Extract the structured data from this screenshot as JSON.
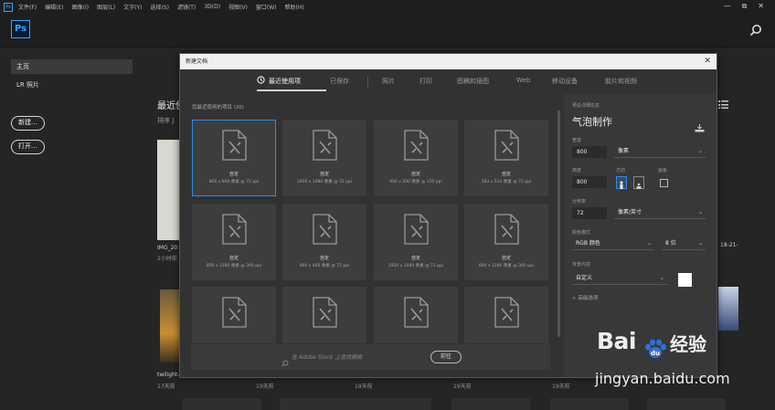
{
  "menubar": {
    "app_icon": "Ps",
    "items": [
      "文件(F)",
      "编辑(E)",
      "图像(I)",
      "图层(L)",
      "文字(Y)",
      "选择(S)",
      "滤镜(T)",
      "3D(D)",
      "视图(V)",
      "窗口(W)",
      "帮助(H)"
    ],
    "controls": [
      "—",
      "⧉",
      "✕"
    ]
  },
  "toolbar": {
    "logo": "Ps",
    "search_icon": "search-icon"
  },
  "sidebar": {
    "items": [
      {
        "label": "主页"
      },
      {
        "label": "LR 照片"
      }
    ],
    "new_button": "新建...",
    "open_button": "打开..."
  },
  "home": {
    "recent_title": "最近使",
    "sort_label": "排序  J",
    "captions_left": {
      "c1": "IMG_20",
      "c1b": "2小时前",
      "c2": "twilight-",
      "c2b": "17天前"
    },
    "captions_bottom": [
      {
        "name": "",
        "time": "19天前"
      },
      {
        "name": "",
        "time": "19天前"
      },
      {
        "name": "",
        "time": "19天前"
      },
      {
        "name": "",
        "time": "19天前"
      }
    ],
    "right_caption": "18-21-"
  },
  "dialog": {
    "title": "新建文档",
    "tabs": [
      {
        "label": "最近使用项",
        "active": true
      },
      {
        "label": "已保存",
        "active": false
      },
      {
        "label": "照片",
        "active": false
      },
      {
        "label": "打印",
        "active": false
      },
      {
        "label": "图稿和插图",
        "active": false
      },
      {
        "label": "Web",
        "active": false
      },
      {
        "label": "移动设备",
        "active": false
      },
      {
        "label": "胶片和视频",
        "active": false
      }
    ],
    "recent_header": "您最近使用的项目 (20)",
    "tiles": [
      {
        "name": "自定",
        "size": "800 x 800 像素 @ 72 ppi",
        "selected": true
      },
      {
        "name": "自定",
        "size": "1920 x 1080 像素 @ 72 ppi",
        "selected": false
      },
      {
        "name": "自定",
        "size": "900 x 500 像素 @ 150 ppi",
        "selected": false
      },
      {
        "name": "自定",
        "size": "583 x 524 像素 @ 72 ppi",
        "selected": false
      },
      {
        "name": "自定",
        "size": "850 x 1280 像素 @ 300 ppi",
        "selected": false
      },
      {
        "name": "自定",
        "size": "900 x 400 像素 @ 72 ppi",
        "selected": false
      },
      {
        "name": "自定",
        "size": "1920 x 1080 像素 @ 72 ppi",
        "selected": false
      },
      {
        "name": "自定",
        "size": "800 x 1280 像素 @ 300 ppi",
        "selected": false
      },
      {
        "name": "",
        "size": "",
        "selected": false
      },
      {
        "name": "",
        "size": "",
        "selected": false
      },
      {
        "name": "",
        "size": "",
        "selected": false
      },
      {
        "name": "",
        "size": "",
        "selected": false
      }
    ],
    "stock_placeholder": "在 Adobe Stock 上查找模板",
    "stock_go": "前往",
    "details": {
      "header": "预设详细信息",
      "name": "气泡制作",
      "width_label": "宽度",
      "width_value": "800",
      "width_unit": "像素",
      "height_label": "高度",
      "height_value": "800",
      "orientation_label": "方向",
      "artboard_label": "画板",
      "resolution_label": "分辨率",
      "resolution_value": "72",
      "resolution_unit": "像素/英寸",
      "color_mode_label": "颜色模式",
      "color_mode_value": "RGB 颜色",
      "bit_depth": "8 位",
      "bg_label": "背景内容",
      "bg_value": "自定义",
      "advanced": "> 高级选项"
    }
  },
  "watermark": {
    "brand_left": "Bai",
    "brand_right": "经验",
    "url": "jingyan.baidu.com"
  },
  "colors": {
    "accent": "#2d8ceb",
    "ps_blue": "#31a8ff",
    "bg": "#252525"
  }
}
